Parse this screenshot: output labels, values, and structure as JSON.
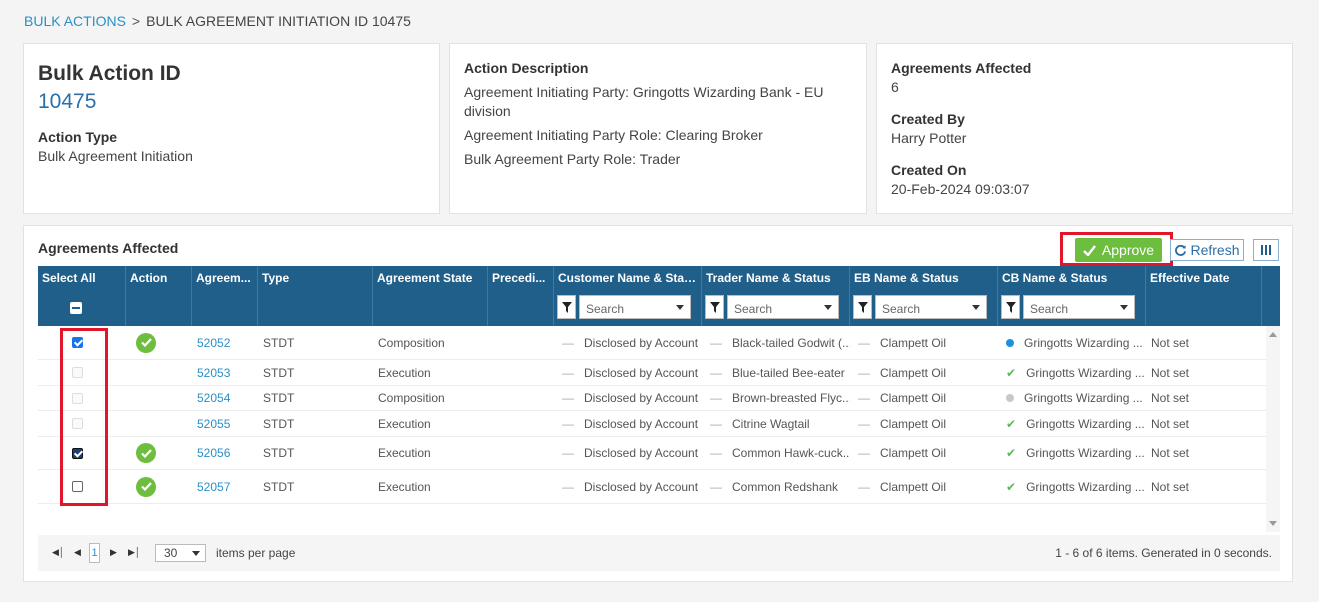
{
  "breadcrumb": {
    "link": "BULK ACTIONS",
    "sep": ">",
    "current": "BULK AGREEMENT INITIATION ID 10475"
  },
  "summary": {
    "title": "Bulk Action ID",
    "id": "10475",
    "action_type_label": "Action Type",
    "action_type_value": "Bulk Agreement Initiation"
  },
  "description": {
    "label": "Action Description",
    "lines": [
      "Agreement Initiating Party: Gringotts Wizarding Bank - EU division",
      "Agreement Initiating Party Role: Clearing Broker",
      "Bulk Agreement Party Role: Trader"
    ]
  },
  "meta": {
    "affected_label": "Agreements Affected",
    "affected_value": "6",
    "created_by_label": "Created By",
    "created_by_value": "Harry Potter",
    "created_on_label": "Created On",
    "created_on_value": "20-Feb-2024 09:03:07"
  },
  "panel": {
    "title": "Agreements Affected",
    "approve_label": "Approve",
    "refresh_label": "Refresh",
    "search_placeholder": "Search"
  },
  "columns": [
    "Select All",
    "Action",
    "Agreem...",
    "Type",
    "Agreement State",
    "Precedi...",
    "Customer Name & Status",
    "Trader Name & Status",
    "EB Name & Status",
    "CB Name & Status",
    "Effective Date"
  ],
  "rows": [
    {
      "select": "checked",
      "action_ok": true,
      "id": "52052",
      "type": "STDT",
      "state": "Composition",
      "customer": "Disclosed by Account",
      "trader": "Black-tailed Godwit (...",
      "eb": "Clampett Oil",
      "cb_status": "blue-dot",
      "cb": "Gringotts Wizarding ...",
      "eff": "Not set"
    },
    {
      "select": "disabled",
      "action_ok": false,
      "id": "52053",
      "type": "STDT",
      "state": "Execution",
      "customer": "Disclosed by Account",
      "trader": "Blue-tailed Bee-eater",
      "eb": "Clampett Oil",
      "cb_status": "check",
      "cb": "Gringotts Wizarding ...",
      "eff": "Not set"
    },
    {
      "select": "disabled",
      "action_ok": false,
      "id": "52054",
      "type": "STDT",
      "state": "Composition",
      "customer": "Disclosed by Account",
      "trader": "Brown-breasted Flyc...",
      "eb": "Clampett Oil",
      "cb_status": "grey-dot",
      "cb": "Gringotts Wizarding ...",
      "eff": "Not set"
    },
    {
      "select": "disabled",
      "action_ok": false,
      "id": "52055",
      "type": "STDT",
      "state": "Execution",
      "customer": "Disclosed by Account",
      "trader": "Citrine Wagtail",
      "eb": "Clampett Oil",
      "cb_status": "check",
      "cb": "Gringotts Wizarding ...",
      "eff": "Not set"
    },
    {
      "select": "checked-dark",
      "action_ok": true,
      "id": "52056",
      "type": "STDT",
      "state": "Execution",
      "customer": "Disclosed by Account",
      "trader": "Common Hawk-cuck...",
      "eb": "Clampett Oil",
      "cb_status": "check",
      "cb": "Gringotts Wizarding ...",
      "eff": "Not set"
    },
    {
      "select": "unchecked",
      "action_ok": true,
      "id": "52057",
      "type": "STDT",
      "state": "Execution",
      "customer": "Disclosed by Account",
      "trader": "Common Redshank",
      "eb": "Clampett Oil",
      "cb_status": "check",
      "cb": "Gringotts Wizarding ...",
      "eff": "Not set"
    }
  ],
  "pager": {
    "current_page": "1",
    "page_size": "30",
    "items_label": "items per page",
    "info": "1 - 6 of 6 items. Generated in 0 seconds."
  },
  "colors": {
    "header_bg": "#1f5f8a",
    "approve": "#6dbe3e",
    "link": "#2a8fc7",
    "highlight": "#e0162b"
  }
}
